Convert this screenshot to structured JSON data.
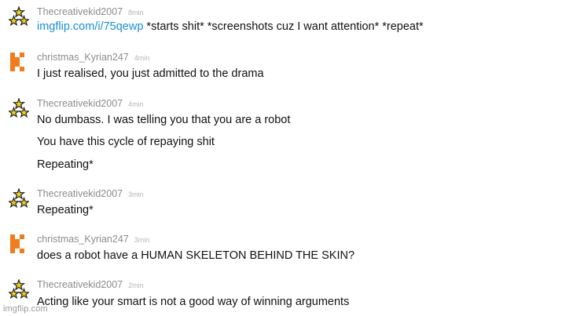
{
  "comments": [
    {
      "username": "Thecreativekid2007",
      "time": "8min",
      "avatar": "stars-avatar-icon",
      "link": "imgflip.com/i/75qewp",
      "lines": [
        " *starts shit* *screenshots cuz I want attention* *repeat*"
      ]
    },
    {
      "username": "christmas_Kyrian247",
      "time": "4min",
      "avatar": "orange-k-avatar-icon",
      "lines": [
        "I just realised, you just admitted to the drama"
      ]
    },
    {
      "username": "Thecreativekid2007",
      "time": "4min",
      "avatar": "stars-avatar-icon",
      "lines": [
        "No dumbass. I was telling you that you are a robot",
        "You have this cycle of repaying shit",
        "Repeating*"
      ]
    },
    {
      "username": "Thecreativekid2007",
      "time": "3min",
      "avatar": "stars-avatar-icon",
      "lines": [
        "Repeating*"
      ]
    },
    {
      "username": "christmas_Kyrian247",
      "time": "3min",
      "avatar": "orange-k-avatar-icon",
      "lines": [
        "does a robot have a HUMAN SKELETON BEHIND THE SKIN?"
      ]
    },
    {
      "username": "Thecreativekid2007",
      "time": "2min",
      "avatar": "stars-avatar-icon",
      "lines": [
        "Acting like your smart is not a good way of winning arguments"
      ]
    }
  ],
  "watermark": "imgflip.com",
  "colors": {
    "link": "#1a8fd6",
    "username": "#8c8c8c",
    "time": "#b5b5b5",
    "k_orange": "#f07c1e",
    "star_yellow": "#f2d21b"
  }
}
